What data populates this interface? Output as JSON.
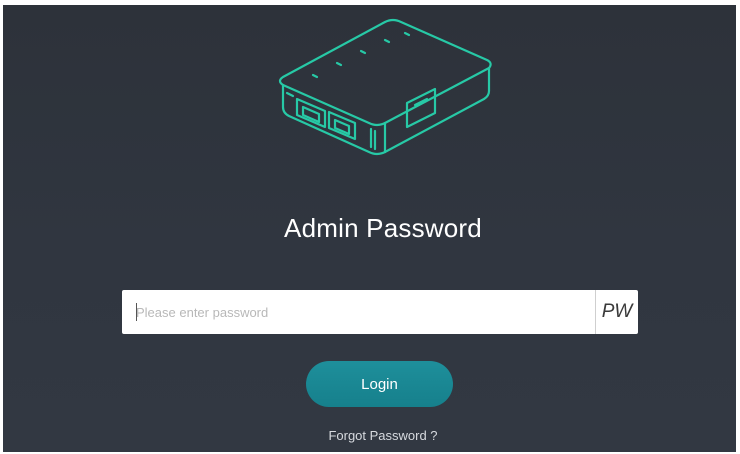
{
  "page": {
    "title": "Admin Password"
  },
  "form": {
    "password_placeholder": "Please enter password",
    "password_value": "",
    "toggle_label": "PW",
    "login_label": "Login",
    "forgot_label": "Forgot Password ?"
  },
  "icons": {
    "device": "router-device-icon"
  },
  "colors": {
    "background": "#303640",
    "accent": "#1b8a96",
    "device_outline": "#27c9a6"
  }
}
